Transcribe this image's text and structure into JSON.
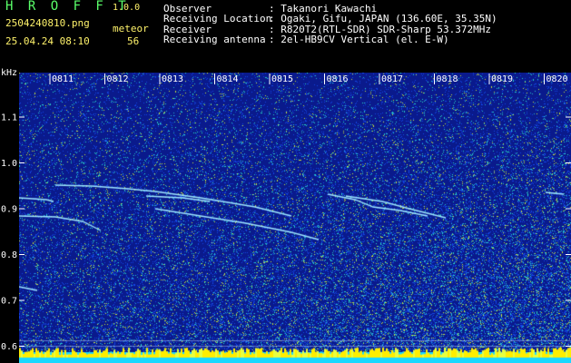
{
  "header": {
    "app_title": "H R O F F T",
    "version": "1.0.0",
    "file_name": "2504240810.png",
    "mode": "meteor",
    "datetime": "25.04.24 08:10",
    "count": "56"
  },
  "info": [
    {
      "label": "Observer",
      "value": ": Takanori Kawachi"
    },
    {
      "label": "Receiving Location",
      "value": ": Ogaki, Gifu, JAPAN (136.60E, 35.35N)"
    },
    {
      "label": "Receiver",
      "value": ": R820T2(RTL-SDR) SDR-Sharp 53.372MHz"
    },
    {
      "label": "Receiving antenna",
      "value": ": 2el-HB9CV Vertical (el. E-W)"
    }
  ],
  "spectrogram": {
    "freq_unit": "kHz",
    "freq_ticks": [
      "1.1",
      "1.0",
      "0.9",
      "0.8",
      "0.7",
      "0.6"
    ],
    "time_ticks": [
      "0811",
      "0812",
      "0813",
      "0814",
      "0815",
      "0816",
      "0817",
      "0818",
      "0819",
      "0820"
    ],
    "colors": {
      "background": "#0a1a8c",
      "noise_low": "#0f3fe0",
      "noise_high": "#2ad0a0",
      "trace": "#9fe8ff",
      "baseline": "#1ad8ff",
      "baseline_peak": "#ffee00",
      "title": "#5aff6a",
      "text": "#fff36b"
    }
  }
}
